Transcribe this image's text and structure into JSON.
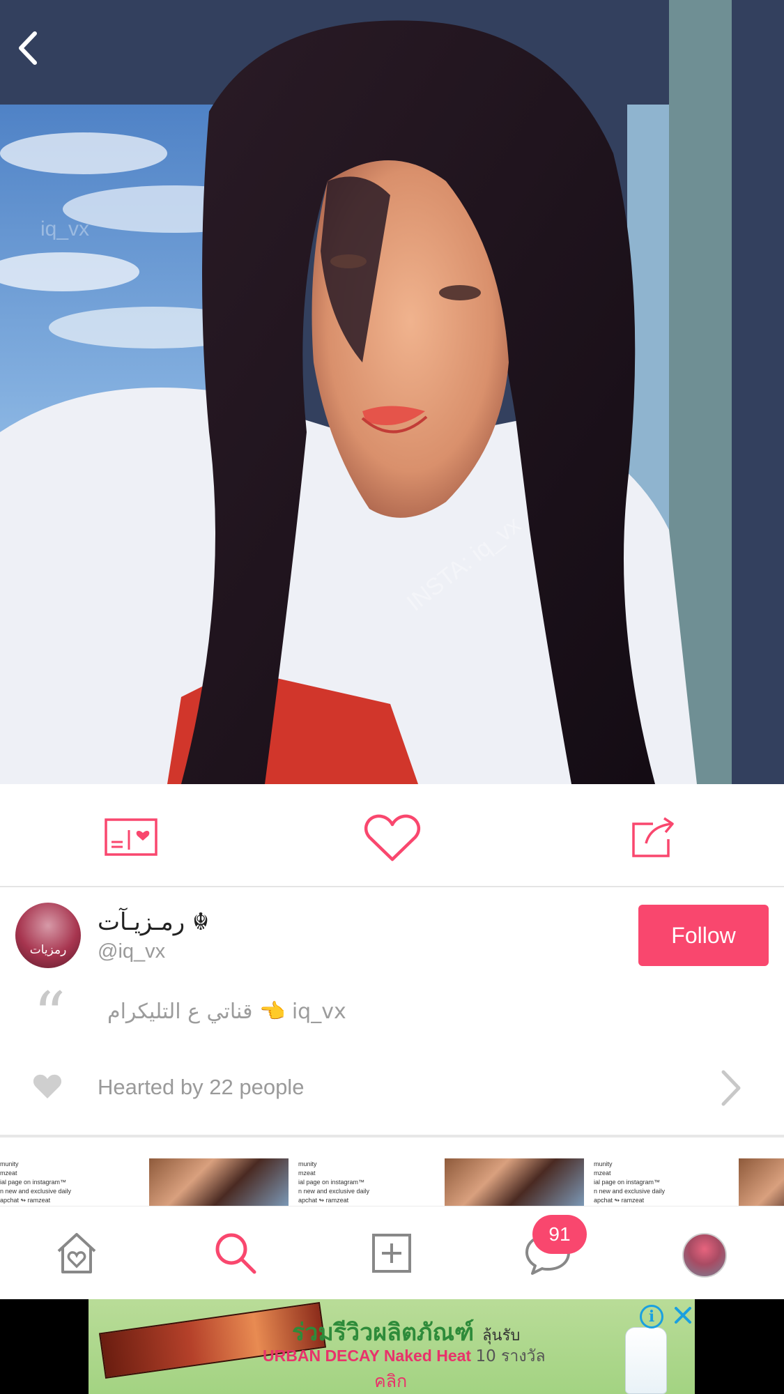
{
  "photo": {
    "watermark_primary": "iq_vx",
    "watermark_secondary": "INSTA: iq_vx"
  },
  "nav": {
    "back_icon": "chevron-left-icon"
  },
  "actions": {
    "items": [
      {
        "icon": "postcard-heart-icon"
      },
      {
        "icon": "heart-outline-icon"
      },
      {
        "icon": "share-icon"
      }
    ]
  },
  "author": {
    "display_name": "رمـزيـآت ☬",
    "username": "@iq_vx",
    "avatar_text": "رمزيات",
    "follow_label": "Follow"
  },
  "caption": {
    "quote_mark": "“",
    "text": "قناتي ع التليكرام 👈 iq_vx"
  },
  "hearts": {
    "text": "Hearted by 22 people"
  },
  "related": {
    "thumb_lines": "munity\nmzeat\nial page on instagram™\nn new and exclusive daily\napchat ↬ ramzeat"
  },
  "tabbar": {
    "tabs": [
      {
        "icon": "home-heart-icon"
      },
      {
        "icon": "search-icon"
      },
      {
        "icon": "add-square-icon"
      },
      {
        "icon": "chat-icon"
      },
      {
        "icon": "profile-avatar-icon"
      }
    ],
    "messages_badge": "91"
  },
  "ad": {
    "title": "ร่วมรีวิวผลิตภัณฑ์",
    "title_suffix": "ลุ้นรับ",
    "product_line": "URBAN DECAY Naked Heat",
    "prize_line": "10 รางวัล",
    "cta": "คลิก",
    "info_symbol": "i"
  },
  "colors": {
    "accent": "#f9476e",
    "muted_text": "#9a9a9a",
    "icon_gray": "#888888"
  }
}
